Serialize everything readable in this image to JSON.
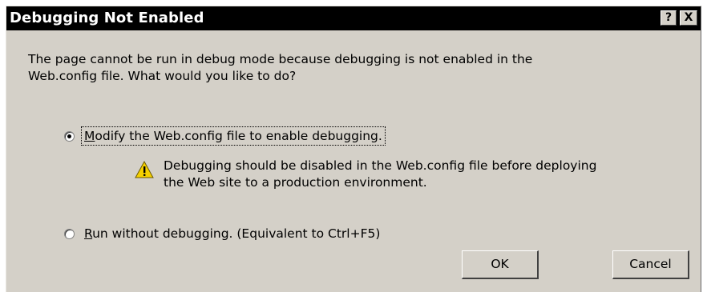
{
  "window": {
    "title": "Debugging Not Enabled",
    "help_label": "?",
    "close_label": "X"
  },
  "message": {
    "line1": "The page cannot be run in debug mode because debugging is not enabled in the",
    "line2": "Web.config file.  What would you like to do?"
  },
  "options": [
    {
      "mnemonic": "M",
      "label_rest": "odify the Web.config file to enable debugging.",
      "selected": true
    },
    {
      "mnemonic": "R",
      "label_rest": "un without debugging. (Equivalent to Ctrl+F5)",
      "selected": false
    }
  ],
  "warning": {
    "icon": "warning-icon",
    "line1": "Debugging should be disabled in the Web.config file before deploying",
    "line2": "the Web site to a production environment."
  },
  "buttons": {
    "ok": "OK",
    "cancel": "Cancel"
  },
  "colors": {
    "title_bar": "#000000",
    "dialog_face": "#d4d0c8",
    "warning_yellow": "#f5d000"
  }
}
